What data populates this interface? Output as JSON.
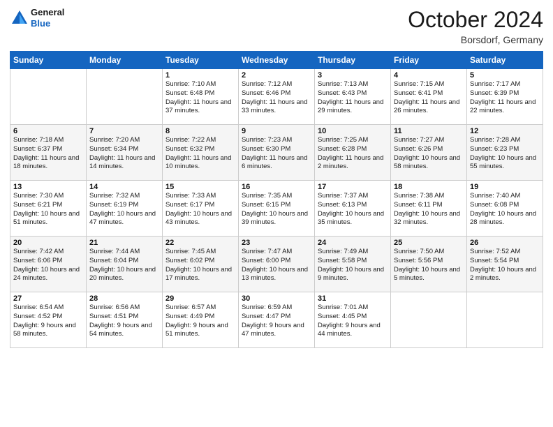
{
  "header": {
    "logo_general": "General",
    "logo_blue": "Blue",
    "month_title": "October 2024",
    "location": "Borsdorf, Germany"
  },
  "weekdays": [
    "Sunday",
    "Monday",
    "Tuesday",
    "Wednesday",
    "Thursday",
    "Friday",
    "Saturday"
  ],
  "weeks": [
    [
      {
        "day": "",
        "info": ""
      },
      {
        "day": "",
        "info": ""
      },
      {
        "day": "1",
        "info": "Sunrise: 7:10 AM\nSunset: 6:48 PM\nDaylight: 11 hours and 37 minutes."
      },
      {
        "day": "2",
        "info": "Sunrise: 7:12 AM\nSunset: 6:46 PM\nDaylight: 11 hours and 33 minutes."
      },
      {
        "day": "3",
        "info": "Sunrise: 7:13 AM\nSunset: 6:43 PM\nDaylight: 11 hours and 29 minutes."
      },
      {
        "day": "4",
        "info": "Sunrise: 7:15 AM\nSunset: 6:41 PM\nDaylight: 11 hours and 26 minutes."
      },
      {
        "day": "5",
        "info": "Sunrise: 7:17 AM\nSunset: 6:39 PM\nDaylight: 11 hours and 22 minutes."
      }
    ],
    [
      {
        "day": "6",
        "info": "Sunrise: 7:18 AM\nSunset: 6:37 PM\nDaylight: 11 hours and 18 minutes."
      },
      {
        "day": "7",
        "info": "Sunrise: 7:20 AM\nSunset: 6:34 PM\nDaylight: 11 hours and 14 minutes."
      },
      {
        "day": "8",
        "info": "Sunrise: 7:22 AM\nSunset: 6:32 PM\nDaylight: 11 hours and 10 minutes."
      },
      {
        "day": "9",
        "info": "Sunrise: 7:23 AM\nSunset: 6:30 PM\nDaylight: 11 hours and 6 minutes."
      },
      {
        "day": "10",
        "info": "Sunrise: 7:25 AM\nSunset: 6:28 PM\nDaylight: 11 hours and 2 minutes."
      },
      {
        "day": "11",
        "info": "Sunrise: 7:27 AM\nSunset: 6:26 PM\nDaylight: 10 hours and 58 minutes."
      },
      {
        "day": "12",
        "info": "Sunrise: 7:28 AM\nSunset: 6:23 PM\nDaylight: 10 hours and 55 minutes."
      }
    ],
    [
      {
        "day": "13",
        "info": "Sunrise: 7:30 AM\nSunset: 6:21 PM\nDaylight: 10 hours and 51 minutes."
      },
      {
        "day": "14",
        "info": "Sunrise: 7:32 AM\nSunset: 6:19 PM\nDaylight: 10 hours and 47 minutes."
      },
      {
        "day": "15",
        "info": "Sunrise: 7:33 AM\nSunset: 6:17 PM\nDaylight: 10 hours and 43 minutes."
      },
      {
        "day": "16",
        "info": "Sunrise: 7:35 AM\nSunset: 6:15 PM\nDaylight: 10 hours and 39 minutes."
      },
      {
        "day": "17",
        "info": "Sunrise: 7:37 AM\nSunset: 6:13 PM\nDaylight: 10 hours and 35 minutes."
      },
      {
        "day": "18",
        "info": "Sunrise: 7:38 AM\nSunset: 6:11 PM\nDaylight: 10 hours and 32 minutes."
      },
      {
        "day": "19",
        "info": "Sunrise: 7:40 AM\nSunset: 6:08 PM\nDaylight: 10 hours and 28 minutes."
      }
    ],
    [
      {
        "day": "20",
        "info": "Sunrise: 7:42 AM\nSunset: 6:06 PM\nDaylight: 10 hours and 24 minutes."
      },
      {
        "day": "21",
        "info": "Sunrise: 7:44 AM\nSunset: 6:04 PM\nDaylight: 10 hours and 20 minutes."
      },
      {
        "day": "22",
        "info": "Sunrise: 7:45 AM\nSunset: 6:02 PM\nDaylight: 10 hours and 17 minutes."
      },
      {
        "day": "23",
        "info": "Sunrise: 7:47 AM\nSunset: 6:00 PM\nDaylight: 10 hours and 13 minutes."
      },
      {
        "day": "24",
        "info": "Sunrise: 7:49 AM\nSunset: 5:58 PM\nDaylight: 10 hours and 9 minutes."
      },
      {
        "day": "25",
        "info": "Sunrise: 7:50 AM\nSunset: 5:56 PM\nDaylight: 10 hours and 5 minutes."
      },
      {
        "day": "26",
        "info": "Sunrise: 7:52 AM\nSunset: 5:54 PM\nDaylight: 10 hours and 2 minutes."
      }
    ],
    [
      {
        "day": "27",
        "info": "Sunrise: 6:54 AM\nSunset: 4:52 PM\nDaylight: 9 hours and 58 minutes."
      },
      {
        "day": "28",
        "info": "Sunrise: 6:56 AM\nSunset: 4:51 PM\nDaylight: 9 hours and 54 minutes."
      },
      {
        "day": "29",
        "info": "Sunrise: 6:57 AM\nSunset: 4:49 PM\nDaylight: 9 hours and 51 minutes."
      },
      {
        "day": "30",
        "info": "Sunrise: 6:59 AM\nSunset: 4:47 PM\nDaylight: 9 hours and 47 minutes."
      },
      {
        "day": "31",
        "info": "Sunrise: 7:01 AM\nSunset: 4:45 PM\nDaylight: 9 hours and 44 minutes."
      },
      {
        "day": "",
        "info": ""
      },
      {
        "day": "",
        "info": ""
      }
    ]
  ]
}
